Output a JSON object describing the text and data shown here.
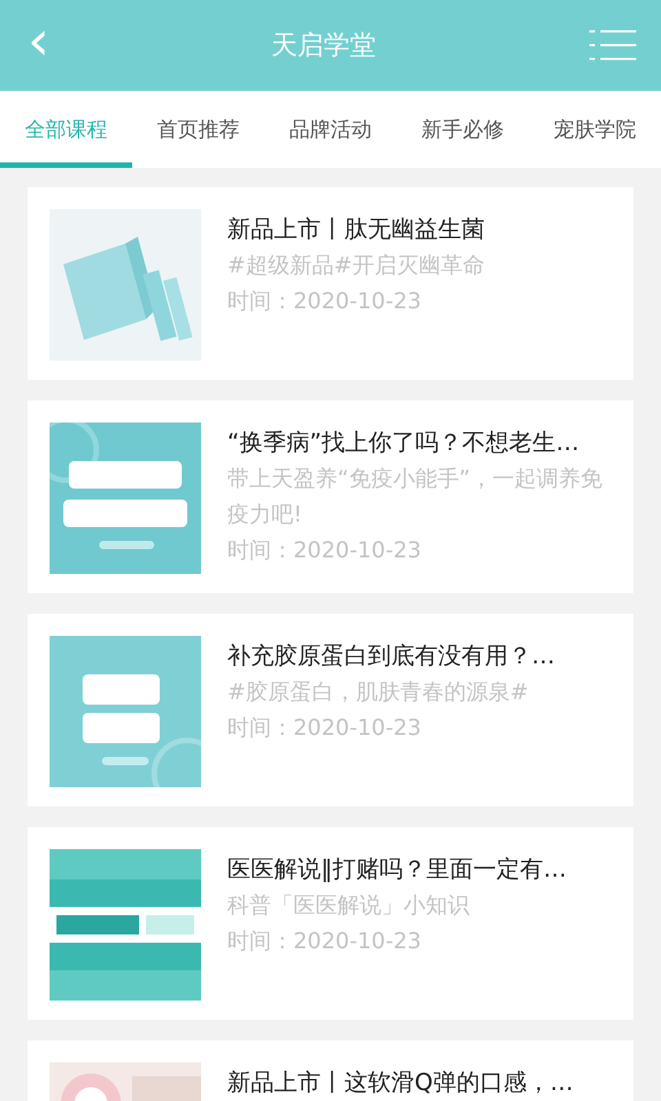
{
  "header": {
    "back": "‹",
    "title": "天启学堂"
  },
  "tabs": [
    {
      "label": "全部课程",
      "selected": true
    },
    {
      "label": "首页推荐",
      "selected": false
    },
    {
      "label": "品牌活动",
      "selected": false
    },
    {
      "label": "新手必修",
      "selected": false
    },
    {
      "label": "宠肤学院",
      "selected": false
    }
  ],
  "articles": [
    {
      "kind": "picture",
      "title": "新品上市丨肽无幽益生菌",
      "summary": "#超级新品#开启灭幽革命",
      "date": "时间：2020-10-23"
    },
    {
      "kind": "picture",
      "title": "“换季病”找上你了吗？不想老生…",
      "summary": "带上天盈养“免疫小能手”，一起调养免疫力吧!",
      "date": "时间：2020-10-23"
    },
    {
      "kind": "picture",
      "title": "补充胶原蛋白到底有没有用？…",
      "summary": "#胶原蛋白，肌肤青春的源泉#",
      "date": "时间：2020-10-23"
    },
    {
      "kind": "picture",
      "title": "医医解说‖打赌吗？里面一定有…",
      "summary": "科普「医医解说」小知识",
      "date": "时间：2020-10-23"
    },
    {
      "kind": "picture",
      "title": "新品上市丨这软滑Q弹的口感，…"
    }
  ]
}
